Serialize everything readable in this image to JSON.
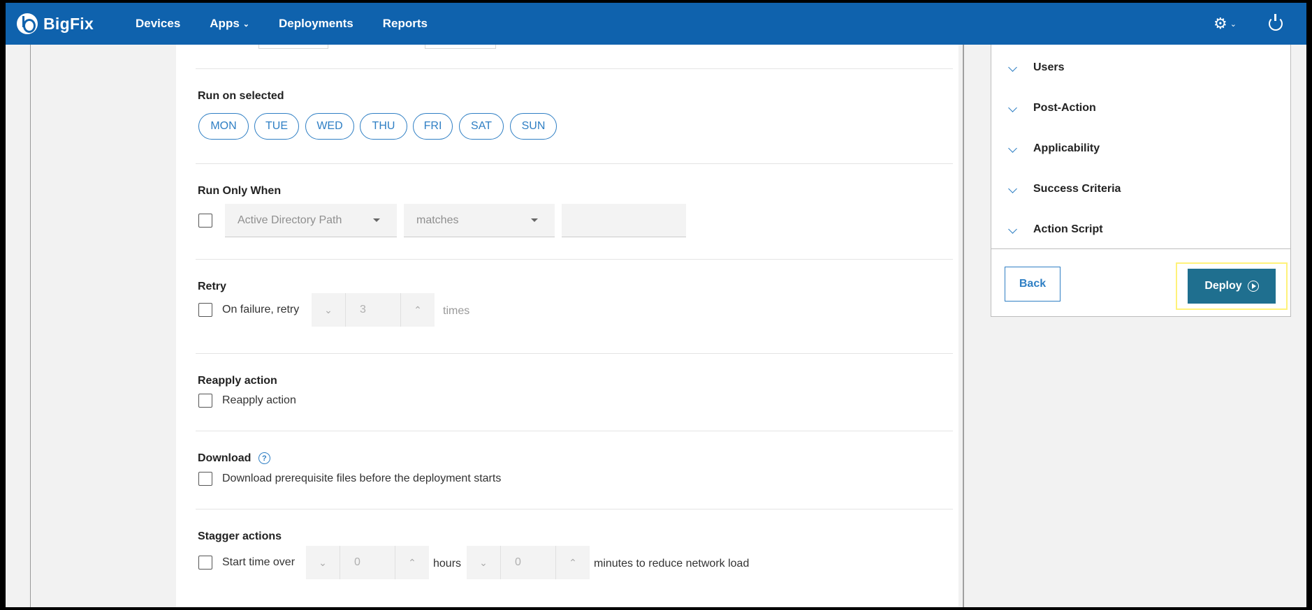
{
  "nav": {
    "brand": "BigFix",
    "items": [
      {
        "label": "Devices"
      },
      {
        "label": "Apps",
        "chevron": "⌄"
      },
      {
        "label": "Deployments"
      },
      {
        "label": "Reports"
      }
    ],
    "gear_icon": "⚙",
    "gear_chevron": "⌄"
  },
  "form": {
    "run_on_selected": {
      "title": "Run on selected",
      "days": [
        "MON",
        "TUE",
        "WED",
        "THU",
        "FRI",
        "SAT",
        "SUN"
      ]
    },
    "run_only_when": {
      "title": "Run Only When",
      "property_select": "Active Directory Path",
      "operator_select": "matches",
      "value": ""
    },
    "retry": {
      "title": "Retry",
      "checkbox_label": "On failure, retry",
      "decrement": "⌄",
      "value": "3",
      "increment": "⌃",
      "unit": "times"
    },
    "reapply": {
      "title": "Reapply action",
      "checkbox_label": "Reapply action"
    },
    "download": {
      "title": "Download",
      "help": "?",
      "checkbox_label": "Download prerequisite files before the deployment starts"
    },
    "stagger": {
      "title": "Stagger actions",
      "checkbox_label": "Start time over",
      "hours_value": "0",
      "hours_unit": "hours",
      "minutes_value": "0",
      "minutes_unit": "minutes to reduce network load",
      "decrement": "⌄",
      "increment": "⌃"
    }
  },
  "side": {
    "items": [
      {
        "label": "Users"
      },
      {
        "label": "Post-Action"
      },
      {
        "label": "Applicability"
      },
      {
        "label": "Success Criteria"
      },
      {
        "label": "Action Script"
      }
    ],
    "back_label": "Back",
    "deploy_label": "Deploy"
  }
}
